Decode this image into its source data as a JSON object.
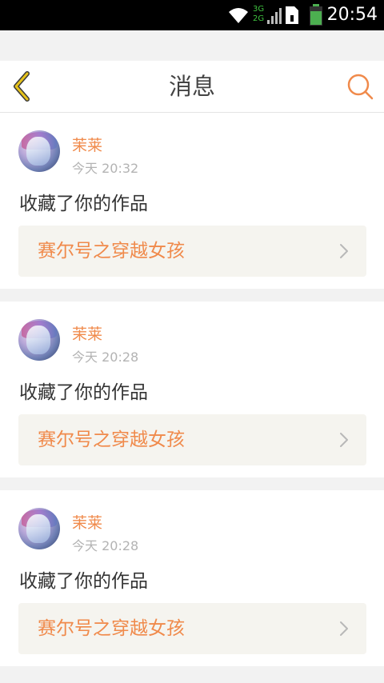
{
  "status_bar": {
    "time": "20:54",
    "network_top": "3G",
    "network_bottom": "2G",
    "icons": [
      "wifi-icon",
      "signal-icon",
      "sim-icon",
      "battery-icon"
    ]
  },
  "header": {
    "title": "消息",
    "back_icon": "chevron-left-icon",
    "search_icon": "search-icon"
  },
  "colors": {
    "accent": "#f08a4b",
    "back_icon": "#e6c21a",
    "header_bg": "#ffffff",
    "page_bg": "#f2f2f2",
    "link_bg": "#f5f4ef"
  },
  "messages": [
    {
      "user": "茉莱",
      "time": "今天 20:32",
      "action": "收藏了你的作品",
      "work_title": "赛尔号之穿越女孩"
    },
    {
      "user": "茉莱",
      "time": "今天 20:28",
      "action": "收藏了你的作品",
      "work_title": "赛尔号之穿越女孩"
    },
    {
      "user": "茉莱",
      "time": "今天 20:28",
      "action": "收藏了你的作品",
      "work_title": "赛尔号之穿越女孩"
    }
  ]
}
